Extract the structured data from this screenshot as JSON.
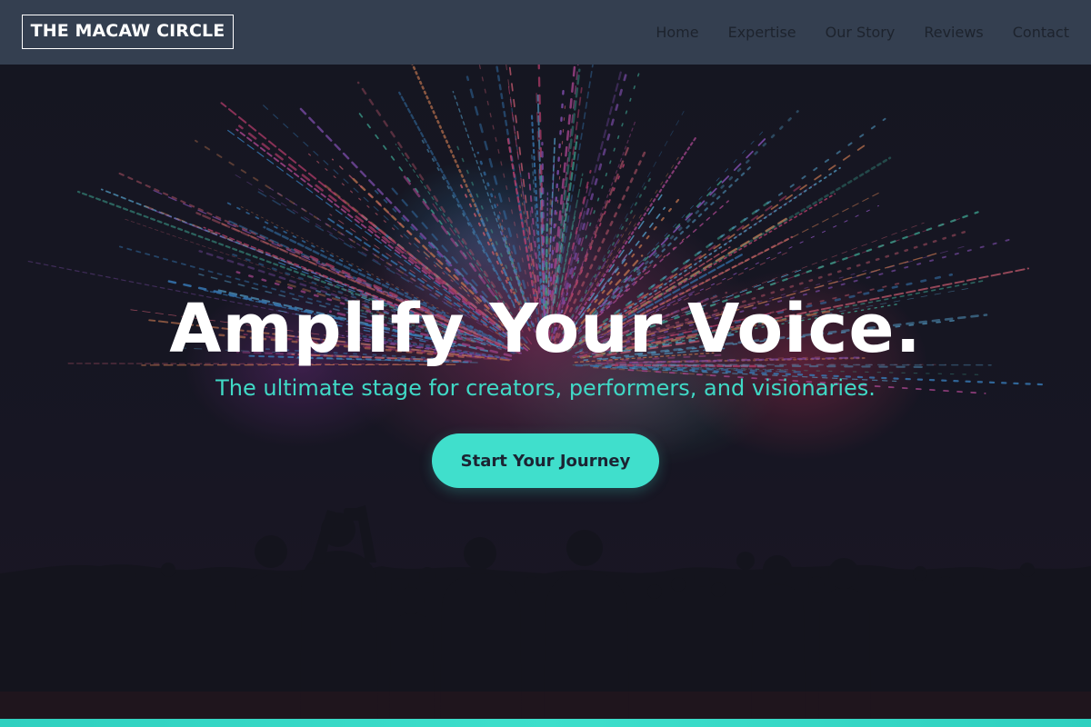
{
  "header": {
    "logo_text": "THE MACAW CIRCLE",
    "nav": [
      {
        "label": "Home"
      },
      {
        "label": "Expertise"
      },
      {
        "label": "Our Story"
      },
      {
        "label": "Reviews"
      },
      {
        "label": "Contact"
      }
    ]
  },
  "hero": {
    "title": "Amplify Your Voice.",
    "subtitle": "The ultimate stage for creators, performers, and visionaries.",
    "cta_label": "Start Your Journey",
    "background_image": "fireworks-over-crowd-silhouette"
  },
  "colors": {
    "header_bg": "#343f50",
    "nav_text": "#1d232d",
    "hero_bg": "#151722",
    "accent": "#40dfcc",
    "subtitle": "#40d9c6",
    "title": "#ffffff"
  }
}
